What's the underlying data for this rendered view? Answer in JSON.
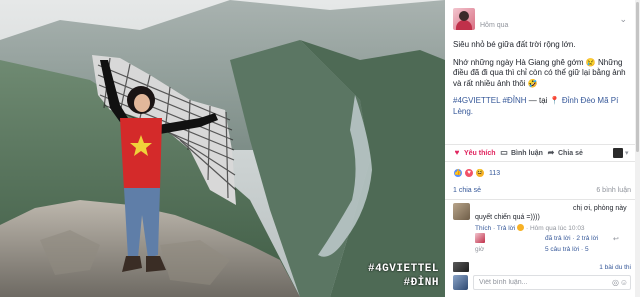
{
  "photo": {
    "hashtags": [
      "#4GVIETTEL",
      "#ĐỈNH"
    ]
  },
  "post": {
    "time": "Hôm qua",
    "paragraph_1": "Siêu nhỏ bé giữa đất trời rộng lớn.",
    "paragraph_2": "Nhớ những ngày Hà Giang ghê gớm 😢 Những điều đã đi qua thì chỉ còn có thể giữ lại bằng ảnh và rất nhiều ảnh thôi 🤣",
    "tag_1": "#4GVIETTEL",
    "tag_2": "#ĐỈNH",
    "tag_sep": " — tại ",
    "location": "Đỉnh Đèo Mã Pí Lèng."
  },
  "actions": {
    "like": "Yêu thích",
    "comment": "Bình luận",
    "share": "Chia sẻ"
  },
  "reactions": {
    "count": "113"
  },
  "stats": {
    "shares": "1 chia sẻ",
    "comments": "6 bình luận"
  },
  "comment": {
    "name": "chị ơi, phòng này",
    "body": "quyết chiến quá =))))",
    "reply_link": "Thích · Trả lời",
    "time": "· Hôm qua lúc 10:03"
  },
  "reply": {
    "text": "đã trả lời · 2 trả lời",
    "sub": "giờ",
    "sub2": "5 câu trả lời · 5"
  },
  "more": {
    "text": "1 bài du thi"
  },
  "composer": {
    "placeholder": "Viết bình luận..."
  }
}
